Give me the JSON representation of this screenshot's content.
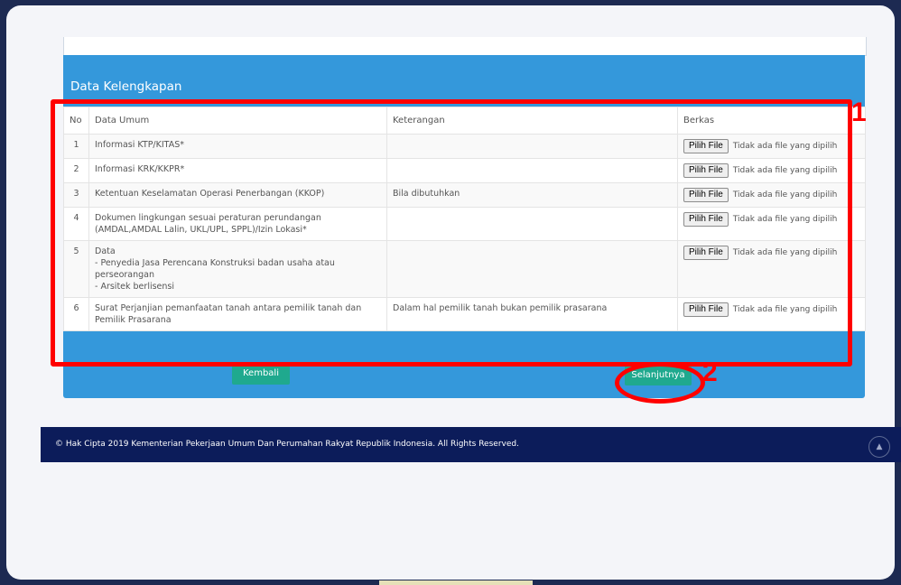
{
  "section": {
    "title": "Data Kelengkapan"
  },
  "table": {
    "headers": {
      "no": "No",
      "data_umum": "Data Umum",
      "keterangan": "Keterangan",
      "berkas": "Berkas"
    },
    "rows": [
      {
        "no": "1",
        "data_umum": "Informasi KTP/KITAS*",
        "keterangan": "",
        "file_button": "Pilih File",
        "file_status": "Tidak ada file yang dipilih"
      },
      {
        "no": "2",
        "data_umum": "Informasi KRK/KKPR*",
        "keterangan": "",
        "file_button": "Pilih File",
        "file_status": "Tidak ada file yang dipilih"
      },
      {
        "no": "3",
        "data_umum": "Ketentuan Keselamatan Operasi Penerbangan (KKOP)",
        "keterangan": "Bila dibutuhkan",
        "file_button": "Pilih File",
        "file_status": "Tidak ada file yang dipilih"
      },
      {
        "no": "4",
        "data_umum": "Dokumen lingkungan sesuai peraturan perundangan\n(AMDAL,AMDAL Lalin, UKL/UPL, SPPL)/Izin Lokasi*",
        "keterangan": "",
        "file_button": "Pilih File",
        "file_status": "Tidak ada file yang dipilih"
      },
      {
        "no": "5",
        "data_umum": "Data\n- Penyedia Jasa Perencana Konstruksi badan usaha atau\nperseorangan\n- Arsitek berlisensi",
        "keterangan": "",
        "file_button": "Pilih File",
        "file_status": "Tidak ada file yang dipilih"
      },
      {
        "no": "6",
        "data_umum": "Surat Perjanjian pemanfaatan tanah antara pemilik tanah dan\nPemilik Prasarana",
        "keterangan": "Dalam hal pemilik tanah bukan pemilik prasarana",
        "file_button": "Pilih File",
        "file_status": "Tidak ada file yang dipilih"
      }
    ]
  },
  "buttons": {
    "back": "Kembali",
    "next": "Selanjutnya"
  },
  "footer": {
    "copyright": "© Hak Cipta 2019 Kementerian Pekerjaan Umum Dan Perumahan Rakyat Republik Indonesia. All Rights Reserved."
  },
  "annotations": {
    "marker_1": "1",
    "marker_2": "2",
    "color": "#ff0000"
  },
  "colors": {
    "background": "#1d2a52",
    "panel": "#3498db",
    "button": "#1fa98e",
    "footer": "#0c1c5a"
  }
}
